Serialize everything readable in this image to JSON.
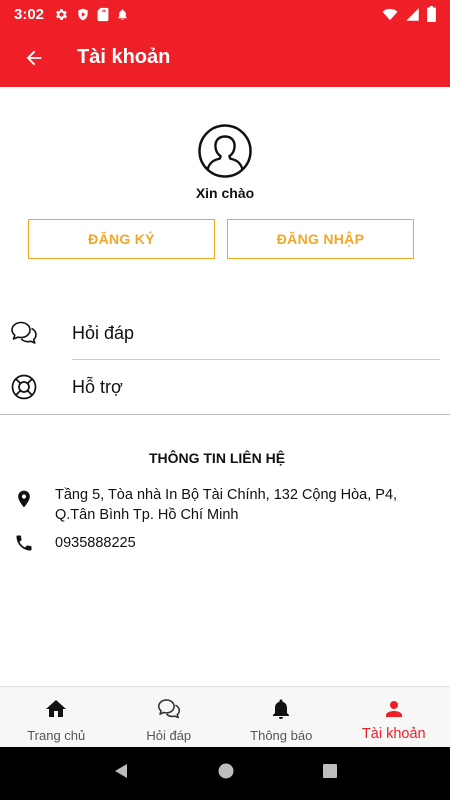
{
  "status_bar": {
    "time": "3:02",
    "left_icons": [
      "gear-icon",
      "shield-icon",
      "sd-card-icon",
      "notification-bell-icon"
    ],
    "right_icons": [
      "wifi-icon",
      "cellular-signal-icon",
      "battery-icon"
    ]
  },
  "app_bar": {
    "title": "Tài khoản",
    "back_icon": "arrow-left-icon",
    "color": "#ee1f26"
  },
  "profile": {
    "avatar_icon": "user-circle-icon",
    "greeting": "Xin chào"
  },
  "auth": {
    "register_label": "ĐĂNG KÝ",
    "login_label": "ĐĂNG NHẬP",
    "accent_color": "#f5a623"
  },
  "menu": {
    "items": [
      {
        "label": "Hỏi đáp",
        "icon": "chat-bubbles-icon"
      },
      {
        "label": "Hỗ trợ",
        "icon": "lifebuoy-icon"
      }
    ]
  },
  "contact": {
    "title": "THÔNG TIN LIÊN HỆ",
    "address": "Tầng 5, Tòa nhà In Bộ Tài Chính, 132 Cộng Hòa, P4, Q.Tân Bình Tp. Hồ Chí Minh",
    "address_icon": "location-pin-icon",
    "phone": "0935888225",
    "phone_icon": "phone-icon"
  },
  "bottom_nav": {
    "active_index": 3,
    "items": [
      {
        "label": "Trang chủ",
        "icon": "home-icon"
      },
      {
        "label": "Hỏi đáp",
        "icon": "chat-bubbles-icon"
      },
      {
        "label": "Thông báo",
        "icon": "bell-icon"
      },
      {
        "label": "Tài khoản",
        "icon": "person-icon"
      }
    ]
  },
  "system_nav": {
    "icons": [
      "back-triangle-icon",
      "home-circle-icon",
      "recents-square-icon"
    ]
  }
}
